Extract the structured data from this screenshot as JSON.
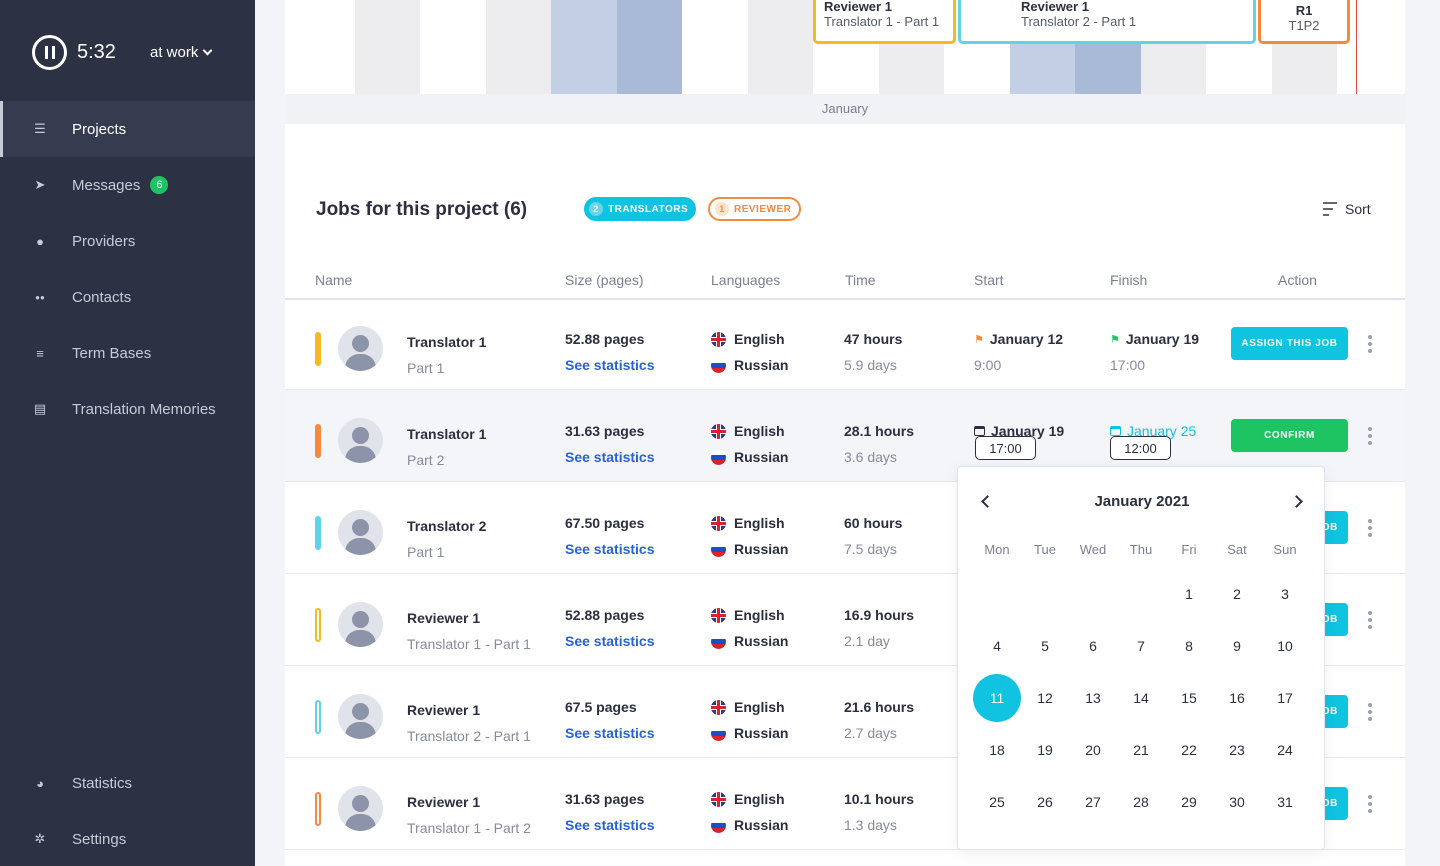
{
  "sidebar": {
    "timer": "5:32",
    "status": "at work",
    "nav": [
      {
        "label": "Projects",
        "icon": "tasks-icon",
        "active": true
      },
      {
        "label": "Messages",
        "icon": "paper-plane-icon",
        "badge": "6"
      },
      {
        "label": "Providers",
        "icon": "user-icon"
      },
      {
        "label": "Contacts",
        "icon": "users-icon"
      },
      {
        "label": "Term Bases",
        "icon": "database-icon"
      },
      {
        "label": "Translation Memories",
        "icon": "book-icon"
      }
    ],
    "nav_bottom": [
      {
        "label": "Statistics",
        "icon": "pie-chart-icon"
      },
      {
        "label": "Settings",
        "icon": "gear-icon"
      }
    ]
  },
  "timeline": {
    "month": "January",
    "cards": [
      {
        "title": "Reviewer 1",
        "subtitle": "Translator 1 - Part 1",
        "color": "#f7b824"
      },
      {
        "title": "Reviewer 1",
        "subtitle": "Translator 2 - Part 1",
        "color": "#5fd3ec"
      },
      {
        "title": "R1",
        "subtitle": "T1P2",
        "color": "#f5893c"
      }
    ]
  },
  "jobs": {
    "title": "Jobs for this project (6)",
    "translators_count": "2",
    "translators_label": "TRANSLATORS",
    "reviewer_count": "1",
    "reviewer_label": "REVIEWER",
    "sort_label": "Sort",
    "columns": {
      "name": "Name",
      "size": "Size (pages)",
      "languages": "Languages",
      "time": "Time",
      "start": "Start",
      "finish": "Finish",
      "action": "Action"
    },
    "rows": [
      {
        "name": "Translator 1",
        "sub": "Part 1",
        "color": "#f7b824",
        "outline": false,
        "size": "52.88 pages",
        "stats": "See statistics",
        "lang1": "English",
        "lang2": "Russian",
        "hours": "47 hours",
        "days": "5.9 days",
        "start_date": "January 12",
        "start_time": "9:00",
        "finish_date": "January 19",
        "finish_time": "17:00",
        "action": "ASSIGN THIS JOB"
      },
      {
        "name": "Translator 1",
        "sub": "Part 2",
        "color": "#f5893c",
        "outline": false,
        "size": "31.63 pages",
        "stats": "See statistics",
        "lang1": "English",
        "lang2": "Russian",
        "hours": "28.1 hours",
        "days": "3.6 days",
        "start_date": "January 19",
        "start_time": "17:00",
        "finish_date": "January 25",
        "finish_time": "12:00",
        "action": "CONFIRM"
      },
      {
        "name": "Translator 2",
        "sub": "Part 1",
        "color": "#5fd3ec",
        "outline": false,
        "size": "67.50 pages",
        "stats": "See statistics",
        "lang1": "English",
        "lang2": "Russian",
        "hours": "60 hours",
        "days": "7.5 days",
        "action": "OB"
      },
      {
        "name": "Reviewer 1",
        "sub": "Translator 1 - Part 1",
        "color": "#f7b824",
        "outline": true,
        "size": "52.88 pages",
        "stats": "See statistics",
        "lang1": "English",
        "lang2": "Russian",
        "hours": "16.9 hours",
        "days": "2.1 day",
        "action": "OB"
      },
      {
        "name": "Reviewer 1",
        "sub": "Translator 2 - Part 1",
        "color": "#5fd3ec",
        "outline": true,
        "size": "67.5 pages",
        "stats": "See statistics",
        "lang1": "English",
        "lang2": "Russian",
        "hours": "21.6 hours",
        "days": "2.7 days",
        "action": "OB"
      },
      {
        "name": "Reviewer 1",
        "sub": "Translator 1 - Part 2",
        "color": "#f5893c",
        "outline": true,
        "size": "31.63 pages",
        "stats": "See statistics",
        "lang1": "English",
        "lang2": "Russian",
        "hours": "10.1 hours",
        "days": "1.3 days",
        "action": "OB"
      }
    ]
  },
  "calendar": {
    "title": "January 2021",
    "weekdays": [
      "Mon",
      "Tue",
      "Wed",
      "Thu",
      "Fri",
      "Sat",
      "Sun"
    ],
    "first_weekday_index": 4,
    "days_in_month": 31,
    "selected_day": 11
  },
  "colors": {
    "accent": "#10c3e0",
    "confirm": "#1ec461",
    "sidebar_bg": "#2c3144",
    "link": "#2a60d8"
  }
}
